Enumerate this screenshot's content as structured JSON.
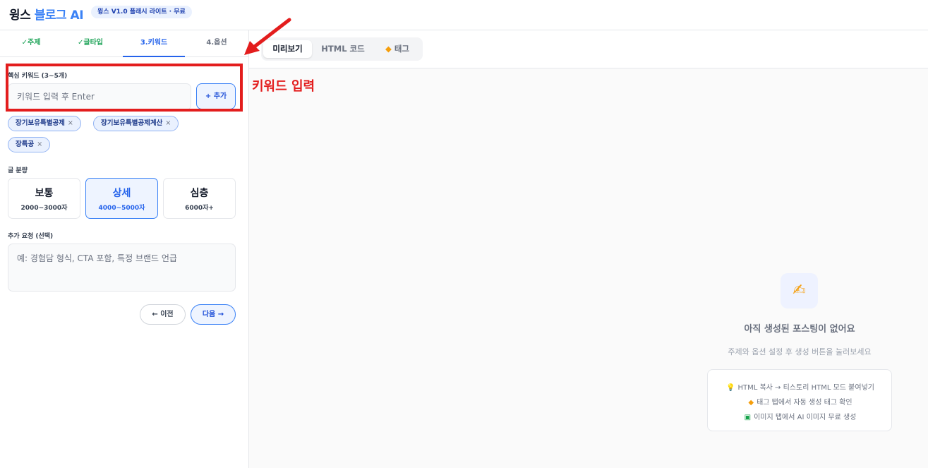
{
  "header": {
    "logo_part1": "윙스",
    "logo_part2": "블로그 AI",
    "version_badge": "윙스 V1.0 플래시 라이트 · 무료"
  },
  "steps": [
    {
      "label": "✓주제",
      "state": "done"
    },
    {
      "label": "✓글타입",
      "state": "done"
    },
    {
      "label": "3.키워드",
      "state": "active"
    },
    {
      "label": "4.옵션",
      "state": "todo"
    }
  ],
  "keywords": {
    "label": "핵심 키워드 (3~5개)",
    "input_value": "",
    "input_placeholder": "키워드 입력 후 Enter",
    "add_label": "+ 추가",
    "chips": [
      "장기보유특별공제",
      "장기보유특별공제계산",
      "장특공"
    ],
    "chip_remove": "×"
  },
  "length": {
    "label": "글 분량",
    "options": [
      {
        "title": "보통",
        "sub": "2000~3000자",
        "selected": false
      },
      {
        "title": "상세",
        "sub": "4000~5000자",
        "selected": true
      },
      {
        "title": "심층",
        "sub": "6000자+",
        "selected": false
      }
    ]
  },
  "extra": {
    "label": "추가 요청 (선택)",
    "input_value": "",
    "placeholder": "예: 경험담 형식, CTA 포함, 특정 브랜드 언급"
  },
  "nav": {
    "prev_label": "← 이전",
    "next_label": "다음 →"
  },
  "preview_tabs": {
    "preview": "미리보기",
    "html": "HTML 코드",
    "tag": "태그",
    "tag_icon": "tag-icon"
  },
  "annotation": "키워드 입력",
  "empty": {
    "icon": "writing-hand-icon",
    "title": "아직 생성된 포스팅이 없어요",
    "subtitle": "주제와 옵션 설정 후 생성 버튼을 눌러보세요",
    "tips": [
      {
        "icon": "bulb-icon",
        "text": "HTML 복사 → 티스토리 HTML 모드 붙여넣기"
      },
      {
        "icon": "tag-icon",
        "text": "태그 탭에서 자동 생성 태그 확인"
      },
      {
        "icon": "image-icon",
        "text": "이미지 탭에서 AI 이미지 무료 생성"
      }
    ]
  },
  "colors": {
    "accent": "#3b82f6",
    "done": "#22a55b",
    "annotation": "#e31d1d"
  }
}
